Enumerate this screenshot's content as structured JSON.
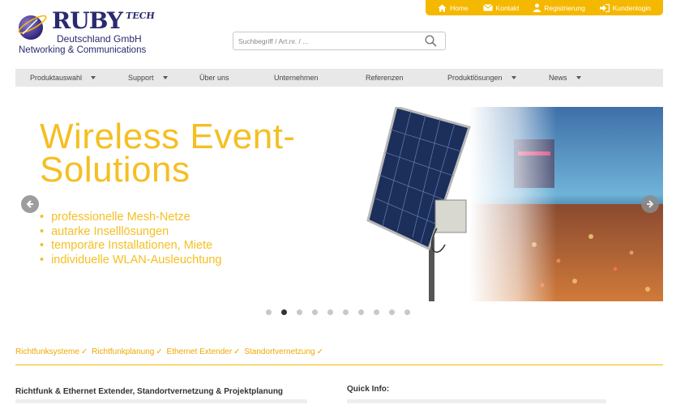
{
  "toplinks": [
    {
      "label": "Home",
      "icon": "home-icon"
    },
    {
      "label": "Kontakt",
      "icon": "envelope-icon"
    },
    {
      "label": "Registrierung",
      "icon": "user-icon"
    },
    {
      "label": "Kundenlogin",
      "icon": "login-icon"
    }
  ],
  "logo": {
    "brand": "RUBY",
    "brand_suffix": "TECH",
    "subtitle": "Deutschland GmbH",
    "tagline": "Networking & Communications"
  },
  "search": {
    "placeholder": "Suchbegriff / Art.nr. / ...",
    "value": ""
  },
  "nav": [
    {
      "label": "Produktauswahl",
      "dropdown": true
    },
    {
      "label": "Support",
      "dropdown": true
    },
    {
      "label": "Über uns",
      "dropdown": false
    },
    {
      "label": "Unternehmen",
      "dropdown": false
    },
    {
      "label": "Referenzen",
      "dropdown": false
    },
    {
      "label": "Produktlösungen",
      "dropdown": true
    },
    {
      "label": "News",
      "dropdown": true
    }
  ],
  "slider": {
    "title_line1": "Wireless Event-",
    "title_line2": "Solutions",
    "bullets": [
      "professionelle Mesh-Netze",
      "autarke Inselllösungen",
      "temporäre Installationen, Miete",
      "individuelle WLAN-Ausleuchtung"
    ],
    "slide_count": 10,
    "active_slide": 2
  },
  "tags": [
    "Richtfunksysteme",
    "Richtfunkplanung",
    "Ethernet Extender",
    "Standortvernetzung"
  ],
  "tag_check": "✓",
  "section": {
    "heading_left": "Richtfunk & Ethernet Extender, Standortvernetzung & Projektplanung",
    "heading_right": "Quick Info:"
  },
  "colors": {
    "accent": "#f5b800",
    "slide_text": "#f5bf22",
    "brand_blue": "#2a2a6e",
    "nav_bg": "#e8e8e8"
  }
}
